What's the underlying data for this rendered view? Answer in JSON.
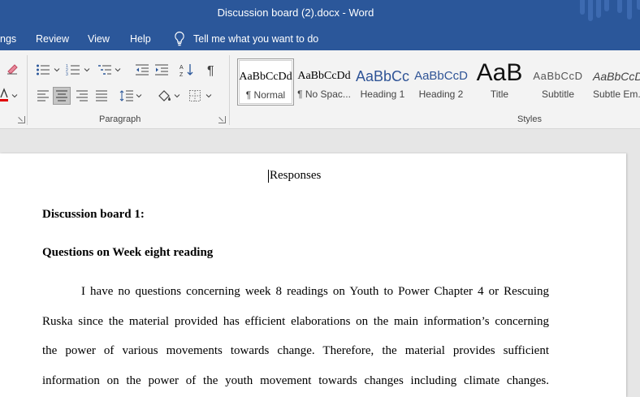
{
  "titlebar": {
    "title": "Discussion board (2).docx  -  Word"
  },
  "menu": {
    "items": [
      "ngs",
      "Review",
      "View",
      "Help"
    ],
    "tell_me": "Tell me what you want to do"
  },
  "ribbon": {
    "paragraph_group_label": "Paragraph",
    "styles_group_label": "Styles",
    "styles": [
      {
        "sample": "AaBbCcDd",
        "name": "¶ Normal"
      },
      {
        "sample": "AaBbCcDd",
        "name": "¶ No Spac..."
      },
      {
        "sample": "AaBbCc",
        "name": "Heading 1"
      },
      {
        "sample": "AaBbCcD",
        "name": "Heading 2"
      },
      {
        "sample": "AaB",
        "name": "Title"
      },
      {
        "sample": "AaBbCcD",
        "name": "Subtitle"
      },
      {
        "sample": "AaBbCcDd",
        "name": "Subtle Em..."
      }
    ],
    "colors": {
      "accent": "#2b579a",
      "heading_blue": "#2f5496",
      "font_red": "#e00000"
    }
  },
  "document": {
    "header": "Responses",
    "heading1": "Discussion board 1:",
    "heading2": "Questions on Week eight reading",
    "para_lines": [
      "I have no questions concerning week 8 readings on Youth to Power Chapter 4 or Rescuing",
      "Ruska since the material provided has efficient elaborations on the main information’s concerning",
      "the power of various movements towards change. Therefore, the material provides sufficient",
      "information on the power of the youth movement towards changes including climate changes."
    ]
  }
}
